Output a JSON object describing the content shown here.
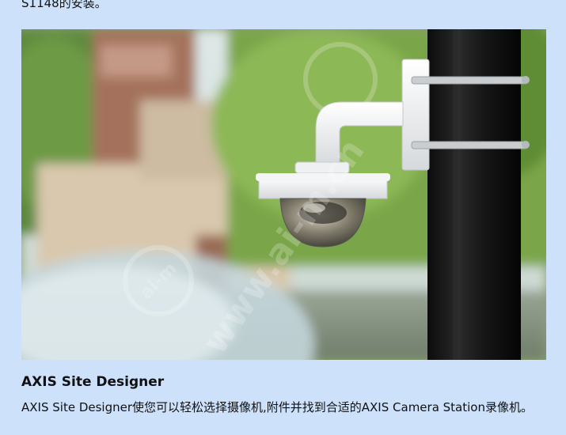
{
  "top_text": "S1148的安装。",
  "image": {
    "subject": "camera-on-pole"
  },
  "section": {
    "title": "AXIS Site Designer",
    "body": "AXIS Site Designer使您可以轻松选择摄像机,附件并找到合适的AXIS Camera Station录像机。"
  },
  "watermark": {
    "text_a": "ai-m",
    "text_b": "www.ai-m.cn"
  },
  "colors": {
    "page_background": "#cde1fb",
    "text": "#111111"
  }
}
